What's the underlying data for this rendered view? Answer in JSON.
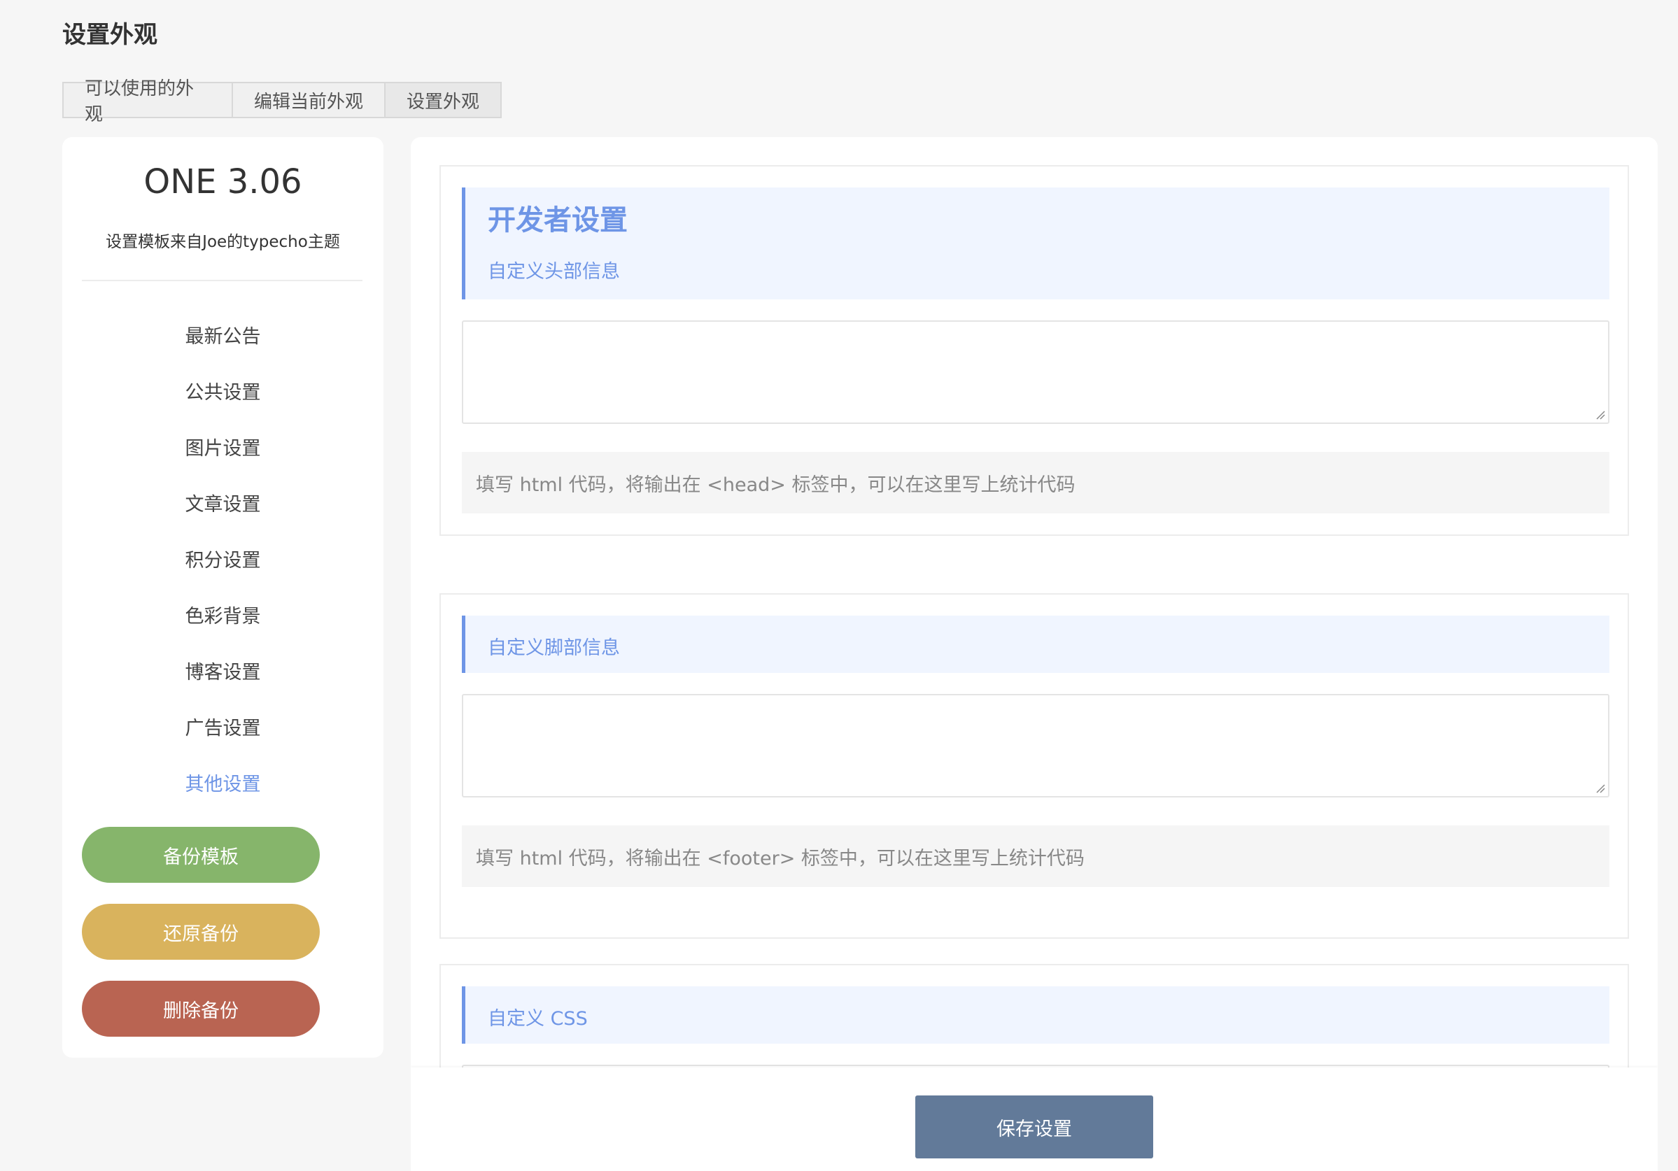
{
  "page": {
    "title": "设置外观"
  },
  "tabs": [
    {
      "label": "可以使用的外观"
    },
    {
      "label": "编辑当前外观"
    },
    {
      "label": "设置外观"
    }
  ],
  "sidebar": {
    "title": "ONE 3.06",
    "subtitle": "设置模板来自Joe的typecho主题",
    "menu": [
      {
        "label": "最新公告"
      },
      {
        "label": "公共设置"
      },
      {
        "label": "图片设置"
      },
      {
        "label": "文章设置"
      },
      {
        "label": "积分设置"
      },
      {
        "label": "色彩背景"
      },
      {
        "label": "博客设置"
      },
      {
        "label": "广告设置"
      },
      {
        "label": "其他设置"
      }
    ],
    "active_item": "其他设置",
    "buttons": {
      "backup": "备份模板",
      "restore": "还原备份",
      "delete": "删除备份"
    }
  },
  "main": {
    "section_title": "开发者设置",
    "sections": [
      {
        "label": "自定义头部信息",
        "value": "",
        "hint": "填写 html 代码，将输出在 <head> 标签中，可以在这里写上统计代码"
      },
      {
        "label": "自定义脚部信息",
        "value": "",
        "hint": "填写 html 代码，将输出在 <footer> 标签中，可以在这里写上统计代码"
      },
      {
        "label": "自定义 CSS",
        "value": ""
      }
    ],
    "save_label": "保存设置"
  },
  "colors": {
    "accent": "#6e95e6",
    "backup_button": "#86b56b",
    "restore_button": "#d9b35d",
    "delete_button": "#b96452",
    "save_button": "#627a99"
  }
}
